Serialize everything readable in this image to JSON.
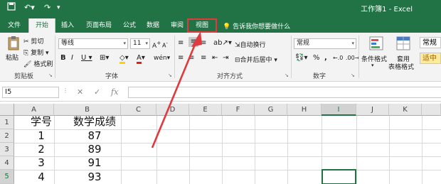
{
  "window": {
    "title": "工作簿1 - Excel"
  },
  "tabs": [
    "文件",
    "开始",
    "插入",
    "页面布局",
    "公式",
    "数据",
    "审阅",
    "视图"
  ],
  "tell_me": "告诉我你想要做什么",
  "ribbon": {
    "clipboard": {
      "paste": "粘贴",
      "cut": "剪切",
      "copy": "复制",
      "format_painter": "格式刷",
      "label": "剪贴板"
    },
    "font": {
      "name": "等线",
      "size": "11",
      "label": "字体"
    },
    "alignment": {
      "wrap": "自动换行",
      "merge": "合并后居中",
      "label": "对齐方式"
    },
    "number": {
      "format": "常规",
      "label": "数字"
    },
    "styles": {
      "conditional": "条件格式",
      "table_format_1": "套用",
      "table_format_2": "表格格式",
      "style_normal": "常规",
      "style_neutral": "适中"
    }
  },
  "formula_bar": {
    "name_box": "I5",
    "fx": "fx"
  },
  "columns": [
    "A",
    "B",
    "C",
    "D",
    "E",
    "F",
    "G",
    "H",
    "I",
    "J",
    "K"
  ],
  "rows": [
    "1",
    "2",
    "3",
    "4",
    "5"
  ],
  "cells": {
    "A1": "学号",
    "B1": "数学成绩",
    "A2": "1",
    "B2": "87",
    "A3": "2",
    "B3": "89",
    "A4": "3",
    "B4": "91",
    "A5": "4",
    "B5": "93"
  },
  "colors": {
    "excel_green": "#217346",
    "annotation_red": "#e0393e"
  }
}
